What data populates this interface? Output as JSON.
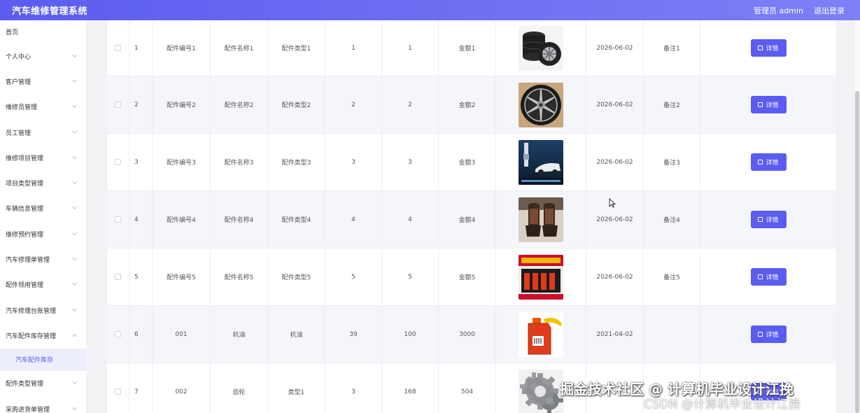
{
  "header": {
    "title": "汽车维修管理系统",
    "user": "管理员 admin",
    "logout": "退出登录"
  },
  "sidebar": {
    "items": [
      {
        "label": "首页"
      },
      {
        "label": "个人中心"
      },
      {
        "label": "客户管理"
      },
      {
        "label": "维修员管理"
      },
      {
        "label": "员工管理"
      },
      {
        "label": "维修项目管理"
      },
      {
        "label": "项目类型管理"
      },
      {
        "label": "车辆信息管理"
      },
      {
        "label": "维修预约管理"
      },
      {
        "label": "汽车修理单管理"
      },
      {
        "label": "配件领用管理"
      },
      {
        "label": "汽车修理台账管理"
      },
      {
        "label": "汽车配件库存管理"
      },
      {
        "label": "配件类型管理"
      },
      {
        "label": "采购进货单管理"
      }
    ],
    "active_sub": "汽车配件库存"
  },
  "table": {
    "detail_label": "详情",
    "rows": [
      {
        "no": "1",
        "code": "配件编号1",
        "name": "配件名称1",
        "type": "配件类型1",
        "q1": "1",
        "q2": "1",
        "amount": "金额1",
        "image": "tires",
        "date": "2026-06-02",
        "note": "备注1"
      },
      {
        "no": "2",
        "code": "配件编号2",
        "name": "配件名称2",
        "type": "配件类型2",
        "q1": "2",
        "q2": "2",
        "amount": "金额2",
        "image": "wheel-rim",
        "date": "2026-06-02",
        "note": "备注2"
      },
      {
        "no": "3",
        "code": "配件编号3",
        "name": "配件名称3",
        "type": "配件类型3",
        "q1": "3",
        "q2": "3",
        "amount": "金额3",
        "image": "spark-plug-ad",
        "date": "2026-06-02",
        "note": "备注3"
      },
      {
        "no": "4",
        "code": "配件编号4",
        "name": "配件名称4",
        "type": "配件类型4",
        "q1": "4",
        "q2": "4",
        "amount": "金额4",
        "image": "seat-cover",
        "date": "2026-06-02",
        "note": "备注4"
      },
      {
        "no": "5",
        "code": "配件编号5",
        "name": "配件名称5",
        "type": "配件类型5",
        "q1": "5",
        "q2": "5",
        "amount": "金额5",
        "image": "ignition-coils",
        "date": "2026-06-02",
        "note": "备注5"
      },
      {
        "no": "6",
        "code": "001",
        "name": "机油",
        "type": "机油",
        "q1": "39",
        "q2": "100",
        "amount": "3000",
        "image": "oil-can",
        "date": "2021-04-02",
        "note": ""
      },
      {
        "no": "7",
        "code": "002",
        "name": "齿轮",
        "type": "类型1",
        "q1": "3",
        "q2": "168",
        "amount": "504",
        "image": "gears",
        "date": "",
        "note": ""
      }
    ]
  },
  "watermark": {
    "main": "掘金技术社区 @ 计算机毕业设计江挽",
    "sub": "CSDN @计算机毕业设计江挽"
  },
  "colors": {
    "accent": "#5b5cf0",
    "header_gradient_end": "#7d80f5",
    "active_bg": "#eceefb"
  }
}
